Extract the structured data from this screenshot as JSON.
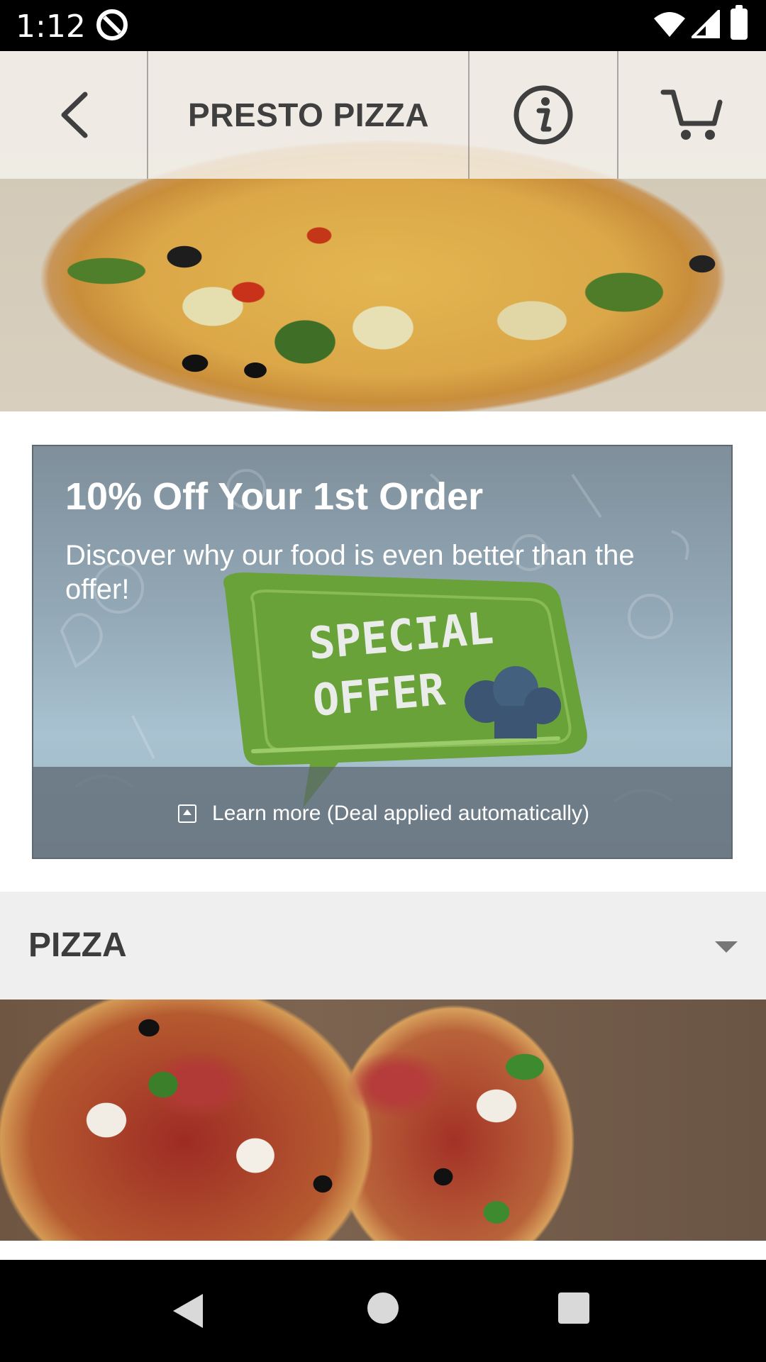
{
  "status_bar": {
    "time": "1:12"
  },
  "header": {
    "title": "PRESTO PIZZA"
  },
  "offer": {
    "headline": "10% Off Your 1st Order",
    "subtitle": "Discover why our food is even better than the offer!",
    "graphic_line1": "SPECIAL",
    "graphic_line2": "OFFER",
    "learn_more": "Learn more (Deal applied automatically)"
  },
  "menu_section": {
    "label": "PIZZA"
  },
  "colors": {
    "offer_green": "#6aa23a",
    "header_text": "#3f3f3f",
    "section_bg": "#efefef"
  },
  "icons": {
    "back": "chevron-left-icon",
    "info": "info-icon",
    "cart": "cart-icon",
    "learn_more": "expand-up-icon",
    "section_toggle": "caret-down-icon"
  }
}
